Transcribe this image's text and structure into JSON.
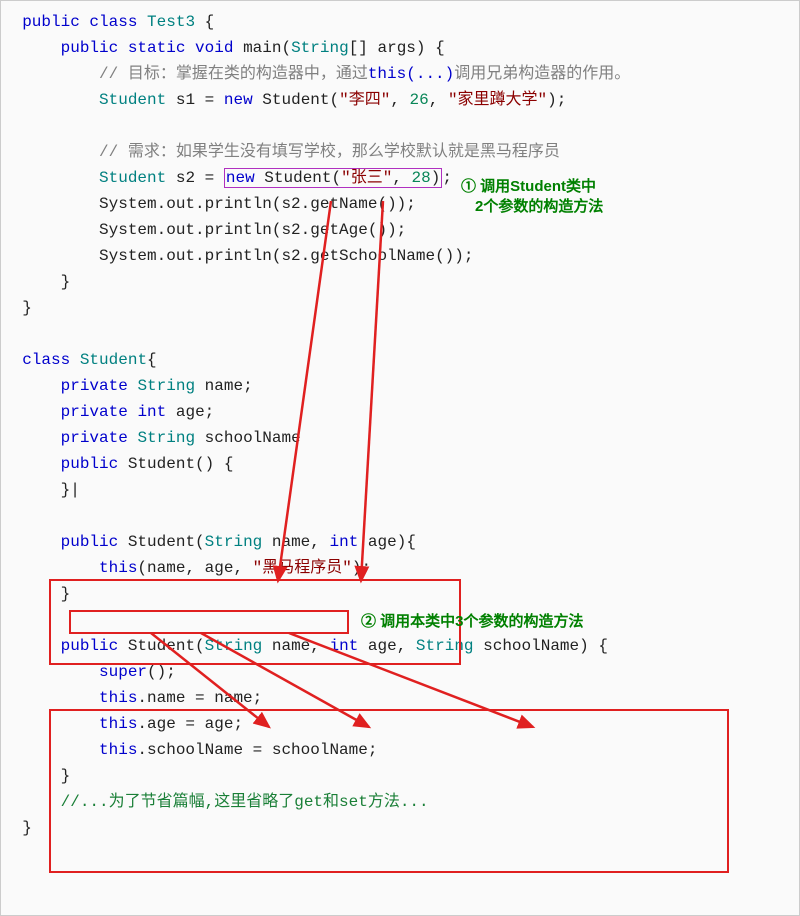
{
  "code": {
    "l1": {
      "kw_public": "public",
      "kw_class": "class",
      "cls": "Test3",
      "brace": " {"
    },
    "l2": {
      "kw_public": "public",
      "kw_static": "static",
      "kw_void": "void",
      "fn": "main",
      "p_open": "(",
      "type": "String",
      "arr": "[]",
      "sp": " ",
      "arg": "args",
      "p_close": ")",
      "brace": " {"
    },
    "l3": {
      "txt": "// 目标：掌握在类的构造器中，通过",
      "this": "this(...)",
      "tail": "调用兄弟构造器的作用。"
    },
    "l4": {
      "type": "Student",
      "sp": " ",
      "var": "s1",
      "eq": " = ",
      "kw_new": "new",
      "sp2": " ",
      "ctor": "Student",
      "p_open": "(",
      "s1": "\"李四\"",
      "c1": ", ",
      "n1": "26",
      "c2": ", ",
      "s2": "\"家里蹲大学\"",
      "p_close": ")",
      "semi": ";"
    },
    "l5": {
      "txt": "// 需求：如果学生没有填写学校，那么学校默认就是黑马程序员"
    },
    "l6": {
      "type": "Student",
      "sp": " ",
      "var": "s2",
      "eq": " = ",
      "kw_new": "new",
      "sp2": " ",
      "ctor": "Student",
      "p_open": "(",
      "s1": "\"张三\"",
      "c1": ", ",
      "n1": "28",
      "p_close": ")",
      "semi": ";"
    },
    "l7": {
      "pre": "System.out.println(s2.getName());"
    },
    "l8": {
      "pre": "System.out.println(s2.getAge());"
    },
    "l9": {
      "pre": "System.out.println(s2.getSchoolName());"
    },
    "l10": {
      "close": "}"
    },
    "l11": {
      "close": "}"
    },
    "l12": {
      "kw_class": "class",
      "cls": "Student",
      "brace": "{"
    },
    "l13": {
      "kw_priv": "private",
      "type": "String",
      "var": "name",
      "semi": ";"
    },
    "l14": {
      "kw_priv": "private",
      "type": "int",
      "var": "age",
      "semi": ";"
    },
    "l15": {
      "kw_priv": "private",
      "type": "String",
      "var": "schoolName"
    },
    "l16": {
      "kw_public": "public",
      "ctor": "Student",
      "paren": "()",
      "brace": " {"
    },
    "l17": {
      "close": "}",
      "cursor": "|"
    },
    "l18": {
      "kw_public": "public",
      "ctor": "Student",
      "p_open": "(",
      "t1": "String",
      "a1": " name",
      "c1": ", ",
      "t2": "int",
      "a2": " age",
      "p_close": ")",
      "brace": "{"
    },
    "l19": {
      "kw_this": "this",
      "p_open": "(",
      "a1": "name",
      "c1": ", ",
      "a2": "age",
      "c2": ", ",
      "s": "\"黑马程序员\"",
      "p_close": ")",
      "semi": ";"
    },
    "l20": {
      "close": "}"
    },
    "l21": {
      "kw_public": "public",
      "ctor": "Student",
      "p_open": "(",
      "t1": "String",
      "a1": " name",
      "c1": ", ",
      "t2": "int",
      "a2": " age",
      "c2": ", ",
      "t3": "String",
      "a3": " schoolName",
      "p_close": ")",
      "brace": " {"
    },
    "l22": {
      "kw_super": "super",
      "paren": "()",
      "semi": ";"
    },
    "l23": {
      "kw_this": "this",
      "dot": ".name = name;"
    },
    "l24": {
      "kw_this": "this",
      "dot": ".age = age;"
    },
    "l25": {
      "kw_this": "this",
      "dot": ".schoolName = schoolName;"
    },
    "l26": {
      "close": "}"
    },
    "l27": {
      "txt": "//...为了节省篇幅,这里省略了get和set方法..."
    },
    "l28": {
      "close": "}"
    }
  },
  "annotations": {
    "a1_line1": "① 调用Student类中",
    "a1_line2": "2个参数的构造方法",
    "a2": "② 调用本类中3个参数的构造方法"
  }
}
